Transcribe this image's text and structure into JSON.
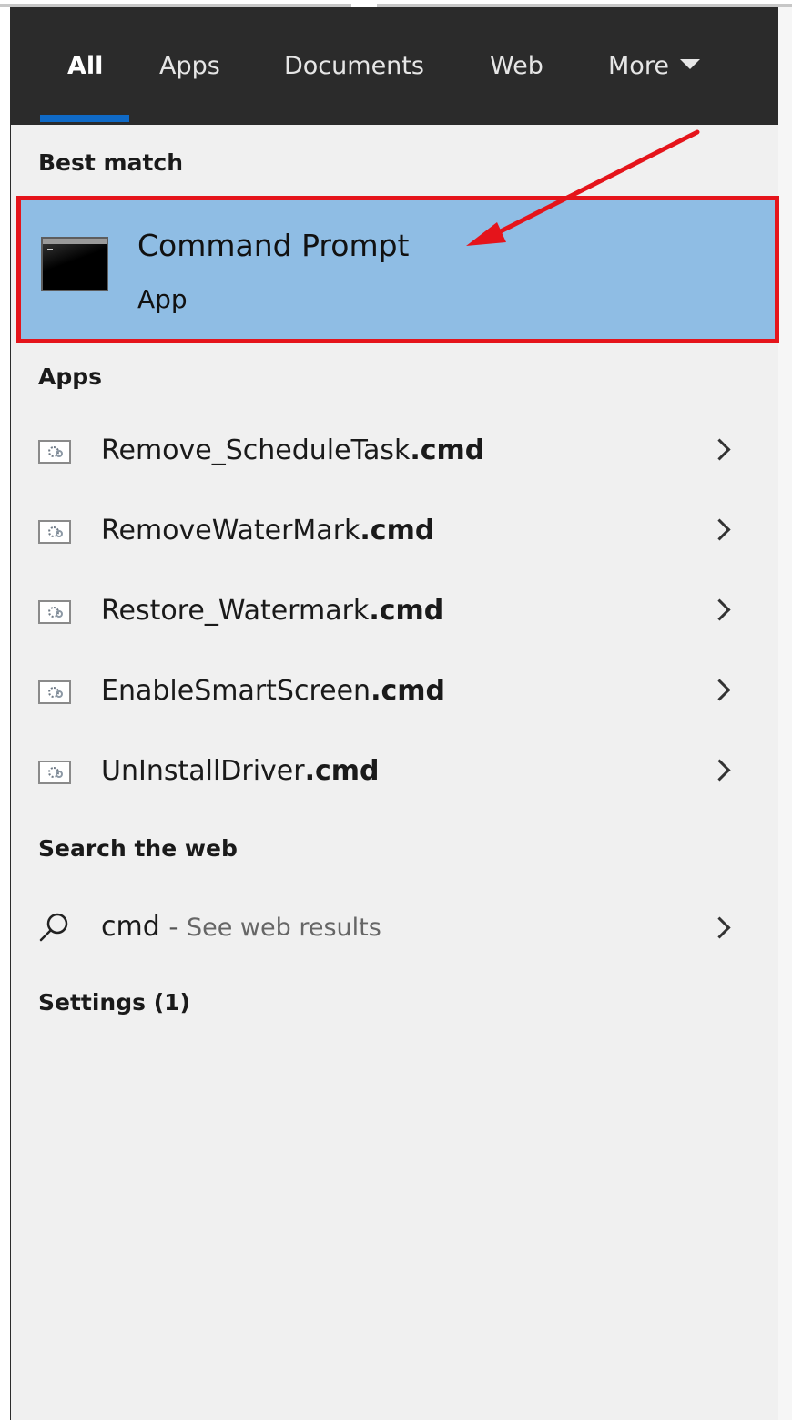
{
  "tabs": [
    {
      "label": "All",
      "active": true
    },
    {
      "label": "Apps",
      "active": false
    },
    {
      "label": "Documents",
      "active": false
    },
    {
      "label": "Web",
      "active": false
    },
    {
      "label": "More",
      "active": false
    }
  ],
  "best_match": {
    "heading": "Best match",
    "title": "Command Prompt",
    "subtitle": "App",
    "icon": "command-prompt-icon"
  },
  "apps": {
    "heading": "Apps",
    "items": [
      {
        "name": "Remove_ScheduleTask",
        "ext": ".cmd",
        "icon": "cmd-script-icon"
      },
      {
        "name": "RemoveWaterMark",
        "ext": ".cmd",
        "icon": "cmd-script-icon"
      },
      {
        "name": "Restore_Watermark",
        "ext": ".cmd",
        "icon": "cmd-script-icon"
      },
      {
        "name": "EnableSmartScreen",
        "ext": ".cmd",
        "icon": "cmd-script-icon"
      },
      {
        "name": "UnInstallDriver",
        "ext": ".cmd",
        "icon": "cmd-script-icon"
      }
    ]
  },
  "web": {
    "heading": "Search the web",
    "query": "cmd",
    "separator": "-",
    "hint": "See web results"
  },
  "settings": {
    "heading": "Settings (1)"
  },
  "colors": {
    "tab_bar": "#2b2b2b",
    "active_underline": "#0f6ac7",
    "selection": "#8fbde4",
    "annotation_red": "#e5141b",
    "panel": "#f0f0f0"
  }
}
